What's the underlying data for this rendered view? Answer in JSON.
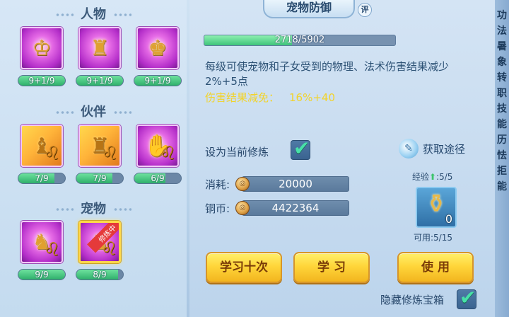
{
  "left": {
    "sections": [
      {
        "title": "人物",
        "skills": [
          {
            "glyph": "♔",
            "level": "9+1/9",
            "progress": 1.0,
            "style": "purple"
          },
          {
            "glyph": "♜",
            "level": "9+1/9",
            "progress": 1.0,
            "style": "purple"
          },
          {
            "glyph": "♚",
            "level": "9+1/9",
            "progress": 1.0,
            "style": "purple"
          }
        ]
      },
      {
        "title": "伙伴",
        "skills": [
          {
            "glyph": "♝",
            "level": "7/9",
            "progress": 0.78,
            "style": "orange"
          },
          {
            "glyph": "♜",
            "level": "7/9",
            "progress": 0.78,
            "style": "orange"
          },
          {
            "glyph": "✋",
            "level": "6/9",
            "progress": 0.67,
            "style": "purple"
          }
        ]
      },
      {
        "title": "宠物",
        "skills": [
          {
            "glyph": "♞",
            "level": "9/9",
            "progress": 1.0,
            "style": "purple"
          },
          {
            "glyph": "♞",
            "level": "8/9",
            "progress": 0.89,
            "style": "purple",
            "selected": true,
            "ribbon": "修炼中"
          }
        ]
      }
    ]
  },
  "main": {
    "title": "宠物防御",
    "comment_badge": "评",
    "exp_text": "2718/5902",
    "exp_progress": 0.46,
    "description": "每级可使宠物和子女受到的物理、法术伤害结果减少2%+5点",
    "effect_label": "伤害结果减免：",
    "effect_value": "16%+40",
    "set_current_label": "设为当前修炼",
    "set_current_checked": true,
    "acquire_label": "获取途径",
    "cost_label": "消耗:",
    "cost_value": "20000",
    "coins_label": "铜币:",
    "coins_value": "4422364",
    "coin_glyph": "◎",
    "treasure": {
      "exp_label": "经验",
      "exp_value": ":5/5",
      "count": "0",
      "usable": "可用:5/15"
    },
    "buttons": {
      "learn_ten": "学习十次",
      "learn": "学 习",
      "use": "使 用"
    },
    "hide_label": "隐藏修炼宝箱",
    "hide_checked": true
  },
  "side_tabs": [
    "功",
    "法",
    "暑",
    "象",
    "转",
    "职",
    "技",
    "能",
    "历",
    "怯",
    "拒",
    "能"
  ],
  "colors": {
    "accent": "#ffd84a",
    "progress": "#3fc47b",
    "effect_text": "#f2d32a"
  }
}
